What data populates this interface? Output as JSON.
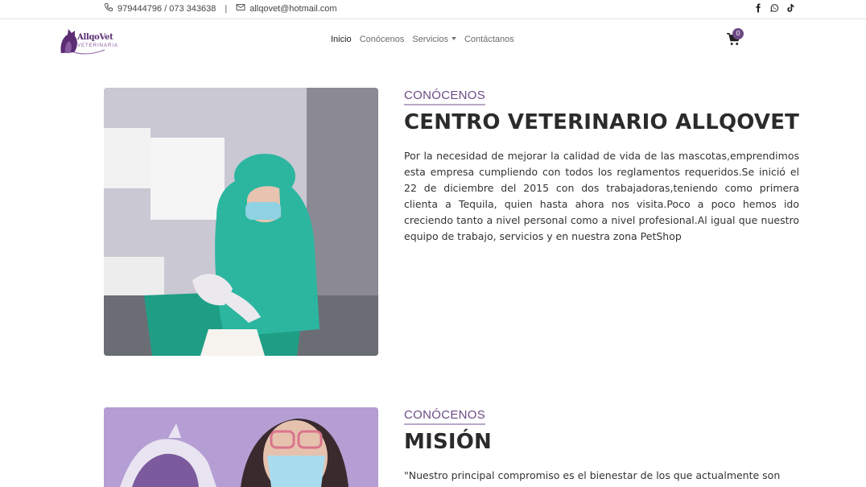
{
  "topbar": {
    "phone": "979444796 / 073 343638",
    "separator": "|",
    "email": "allqovet@hotmail.com",
    "social": [
      "facebook-icon",
      "whatsapp-icon",
      "tiktok-icon"
    ]
  },
  "brand": {
    "name": "AllqoVet",
    "tagline": "VETERINARIA",
    "accent": "#6c4b86"
  },
  "nav": {
    "items": [
      {
        "label": "Inicio",
        "active": true
      },
      {
        "label": "Conócenos",
        "active": false
      },
      {
        "label": "Servicios",
        "active": false,
        "dropdown": true
      },
      {
        "label": "Contáctanos",
        "active": false
      }
    ],
    "cart_count": "0"
  },
  "sections": [
    {
      "eyebrow": "CONÓCENOS",
      "title": "CENTRO VETERINARIO ALLQOVET",
      "body": "Por la necesidad de mejorar la calidad de vida de las mascotas,emprendimos esta empresa cumpliendo con todos los reglamentos requeridos.Se inició el 22 de diciembre del 2015 con dos trabajadoras,teniendo como primera clienta a Tequila, quien hasta ahora nos visita.Poco a poco hemos ido creciendo tanto a nivel personal como a nivel profesional.Al igual que nuestro equipo de trabajo, servicios y en nuestra zona PetShop"
    },
    {
      "eyebrow": "CONÓCENOS",
      "title": "MISIÓN",
      "body": "\"Nuestro principal compromiso es el bienestar de los que actualmente son"
    }
  ]
}
